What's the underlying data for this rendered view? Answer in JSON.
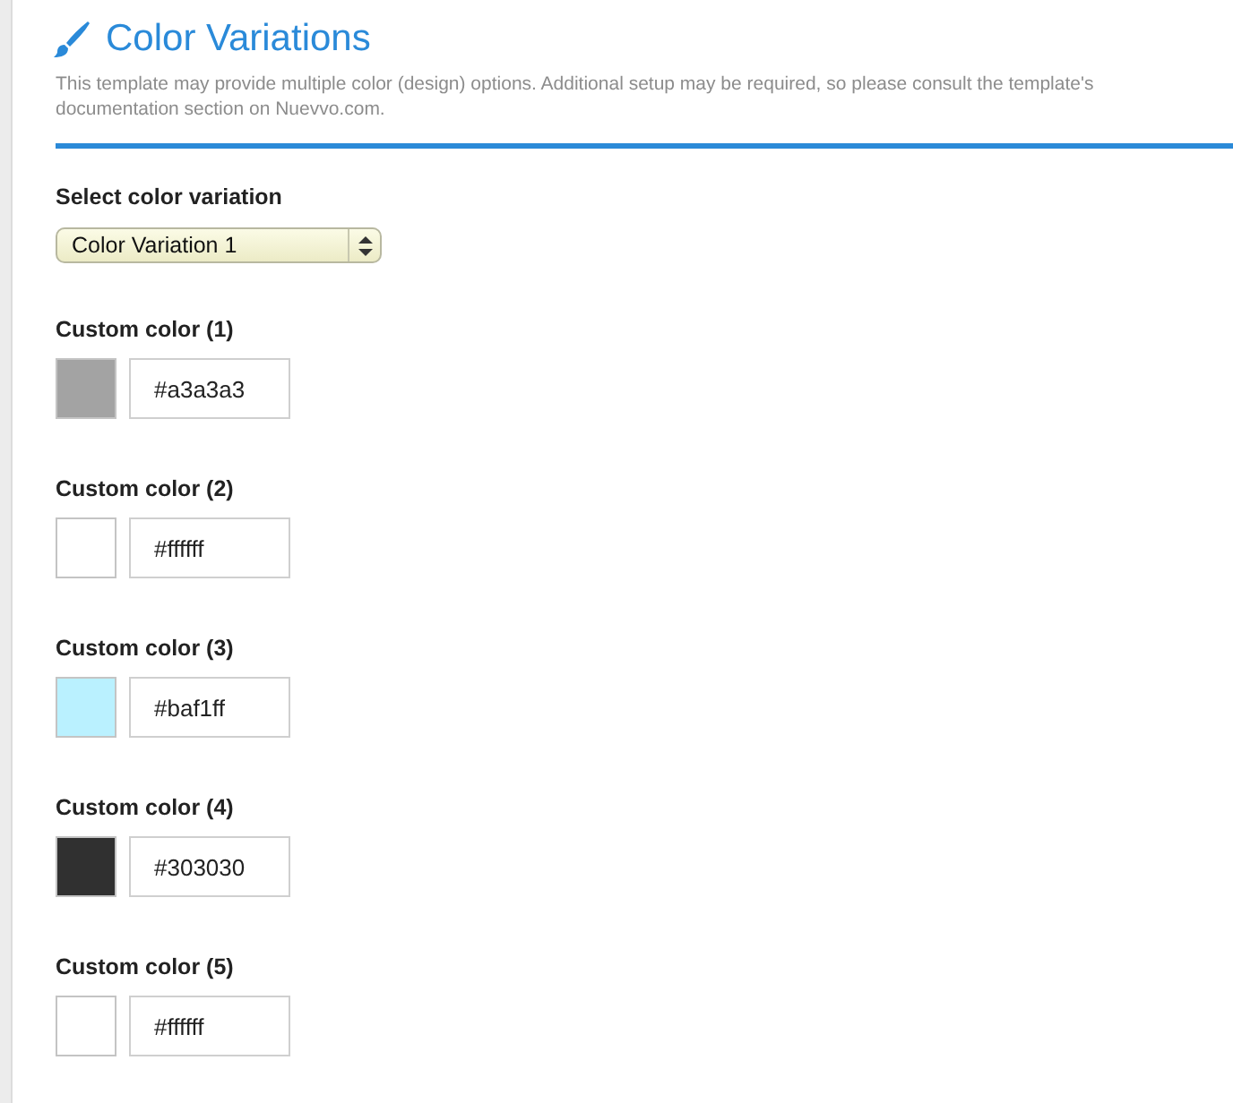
{
  "header": {
    "title": "Color Variations",
    "description": "This template may provide multiple color (design) options. Additional setup may be required, so please consult the template's documentation section on Nuevvo.com."
  },
  "variation": {
    "label": "Select color variation",
    "value": "Color Variation 1"
  },
  "custom_colors": [
    {
      "label": "Custom color (1)",
      "color": "#a3a3a3",
      "value": "#a3a3a3"
    },
    {
      "label": "Custom color (2)",
      "color": "#ffffff",
      "value": "#ffffff"
    },
    {
      "label": "Custom color (3)",
      "color": "#baf1ff",
      "value": "#baf1ff"
    },
    {
      "label": "Custom color (4)",
      "color": "#303030",
      "value": "#303030"
    },
    {
      "label": "Custom color (5)",
      "color": "#ffffff",
      "value": "#ffffff"
    }
  ]
}
